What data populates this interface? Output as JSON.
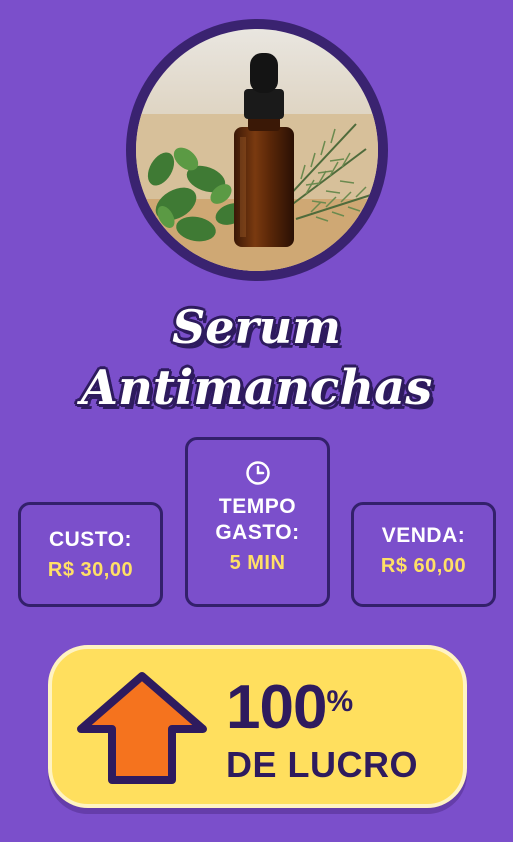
{
  "product": {
    "title_line1": "Serum",
    "title_line2": "Antimanchas"
  },
  "stats": {
    "cost_label": "CUSTO:",
    "cost_value": "R$ 30,00",
    "time_label_line1": "TEMPO",
    "time_label_line2": "GASTO:",
    "time_value": "5 MIN",
    "sale_label": "VENDA:",
    "sale_value": "R$ 60,00"
  },
  "profit": {
    "percent_number": "100",
    "percent_sign": "%",
    "text": "DE LUCRO"
  },
  "icons": {
    "time": "clock-icon",
    "profit": "arrow-up-icon"
  },
  "colors": {
    "background": "#7b4fcb",
    "accent": "#ffe066",
    "banner": "#ffdf5e",
    "dark": "#2e1b5e",
    "arrow": "#f5731e"
  }
}
